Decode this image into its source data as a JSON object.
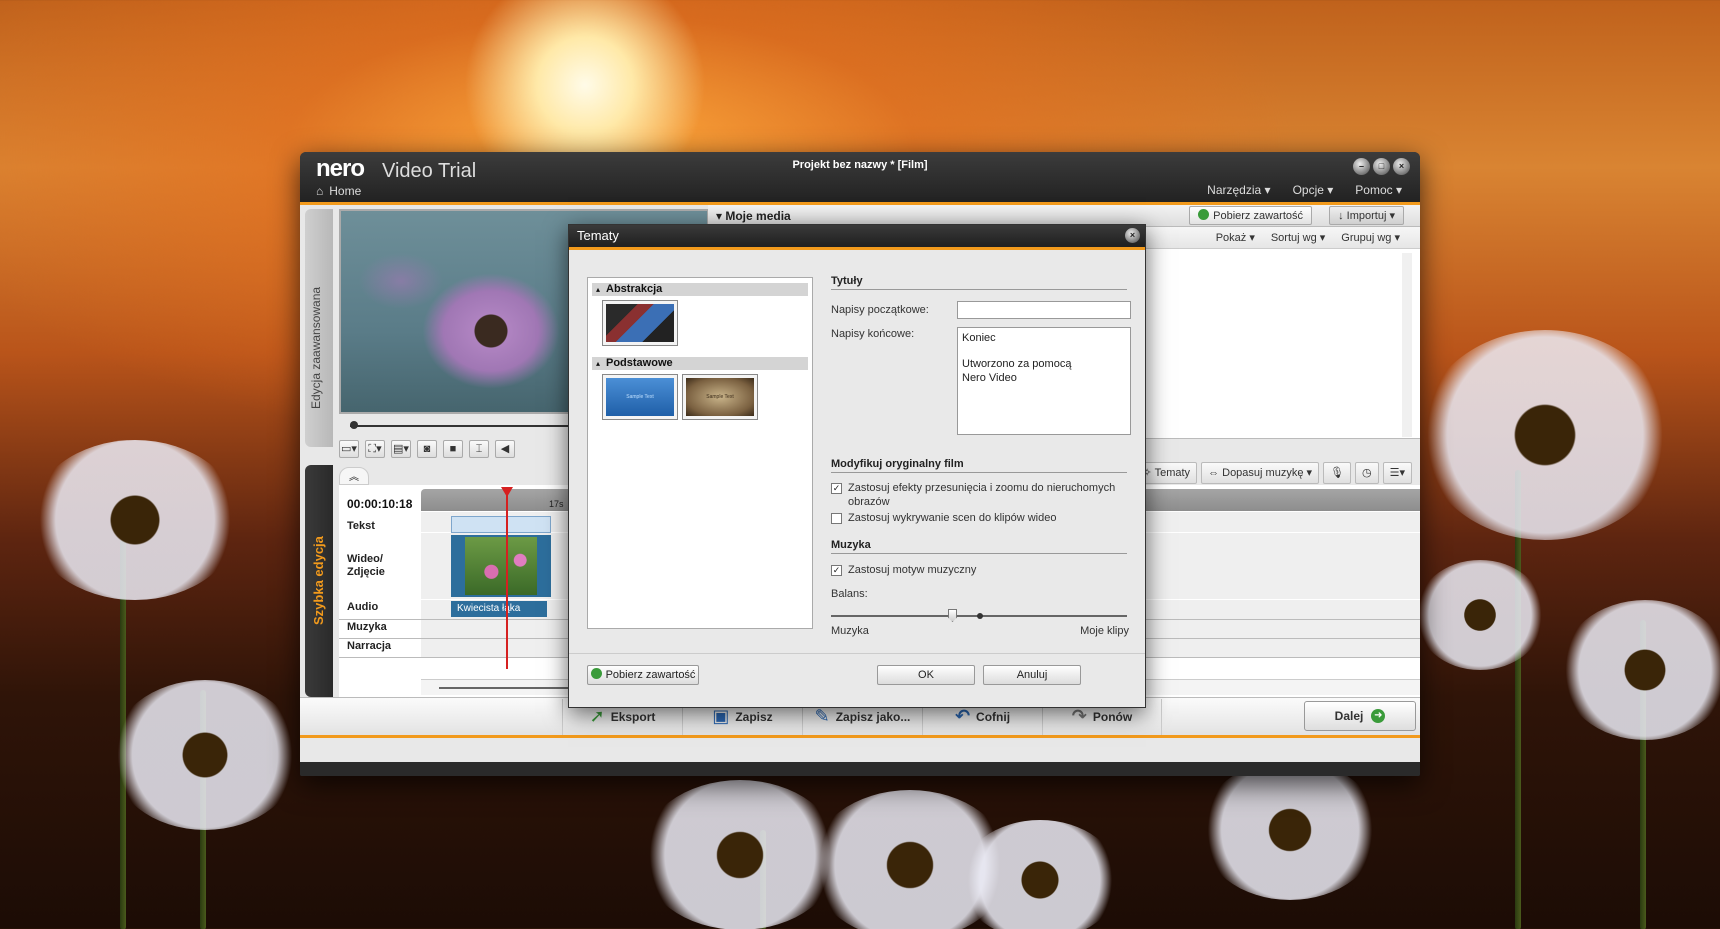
{
  "window": {
    "logo": "nero",
    "app_name": "Video Trial",
    "project_title": "Projekt bez nazwy * [Film]",
    "home": "Home",
    "menu": [
      "Narzędzia",
      "Opcje",
      "Pomoc"
    ]
  },
  "side_tabs": {
    "advanced": "Edycja zaawansowana",
    "quick": "Szybka edycja"
  },
  "media": {
    "title": "Moje media",
    "get_content": "Pobierz zawartość",
    "import": "Importuj",
    "show": "Pokaż",
    "sort": "Sortuj wg",
    "group": "Grupuj wg"
  },
  "tools": {
    "themes": "Tematy",
    "fit_music": "Dopasuj muzykę"
  },
  "timeline": {
    "time": "00:00:10:18",
    "ruler_mark": "17s",
    "tracks": {
      "text": "Tekst",
      "video": "Wideo/ Zdjęcie",
      "audio": "Audio",
      "music": "Muzyka",
      "narration": "Narracja"
    },
    "audio_clip": "Kwiecista łąka"
  },
  "bottom": {
    "export": "Eksport",
    "save": "Zapisz",
    "save_as": "Zapisz jako...",
    "undo": "Cofnij",
    "redo": "Ponów",
    "next": "Dalej"
  },
  "dialog": {
    "title": "Tematy",
    "groups": {
      "abstract": "Abstrakcja",
      "basic": "Podstawowe"
    },
    "thumb_text": "Sample Text",
    "titles_section": "Tytuły",
    "opening_label": "Napisy początkowe:",
    "opening_value": "",
    "closing_label": "Napisy końcowe:",
    "closing_line1": "Koniec",
    "closing_line2": "Utworzono za pomocą",
    "closing_line3": "Nero Video",
    "modify_section": "Modyfikuj oryginalny film",
    "chk_pan_zoom": "Zastosuj efekty przesunięcia i zoomu do nieruchomych obrazów",
    "chk_scene": "Zastosuj wykrywanie scen do klipów wideo",
    "music_section": "Muzyka",
    "chk_music": "Zastosuj motyw muzyczny",
    "balance_label": "Balans:",
    "balance_left": "Muzyka",
    "balance_right": "Moje klipy",
    "get_content": "Pobierz zawartość",
    "ok": "OK",
    "cancel": "Anuluj"
  }
}
